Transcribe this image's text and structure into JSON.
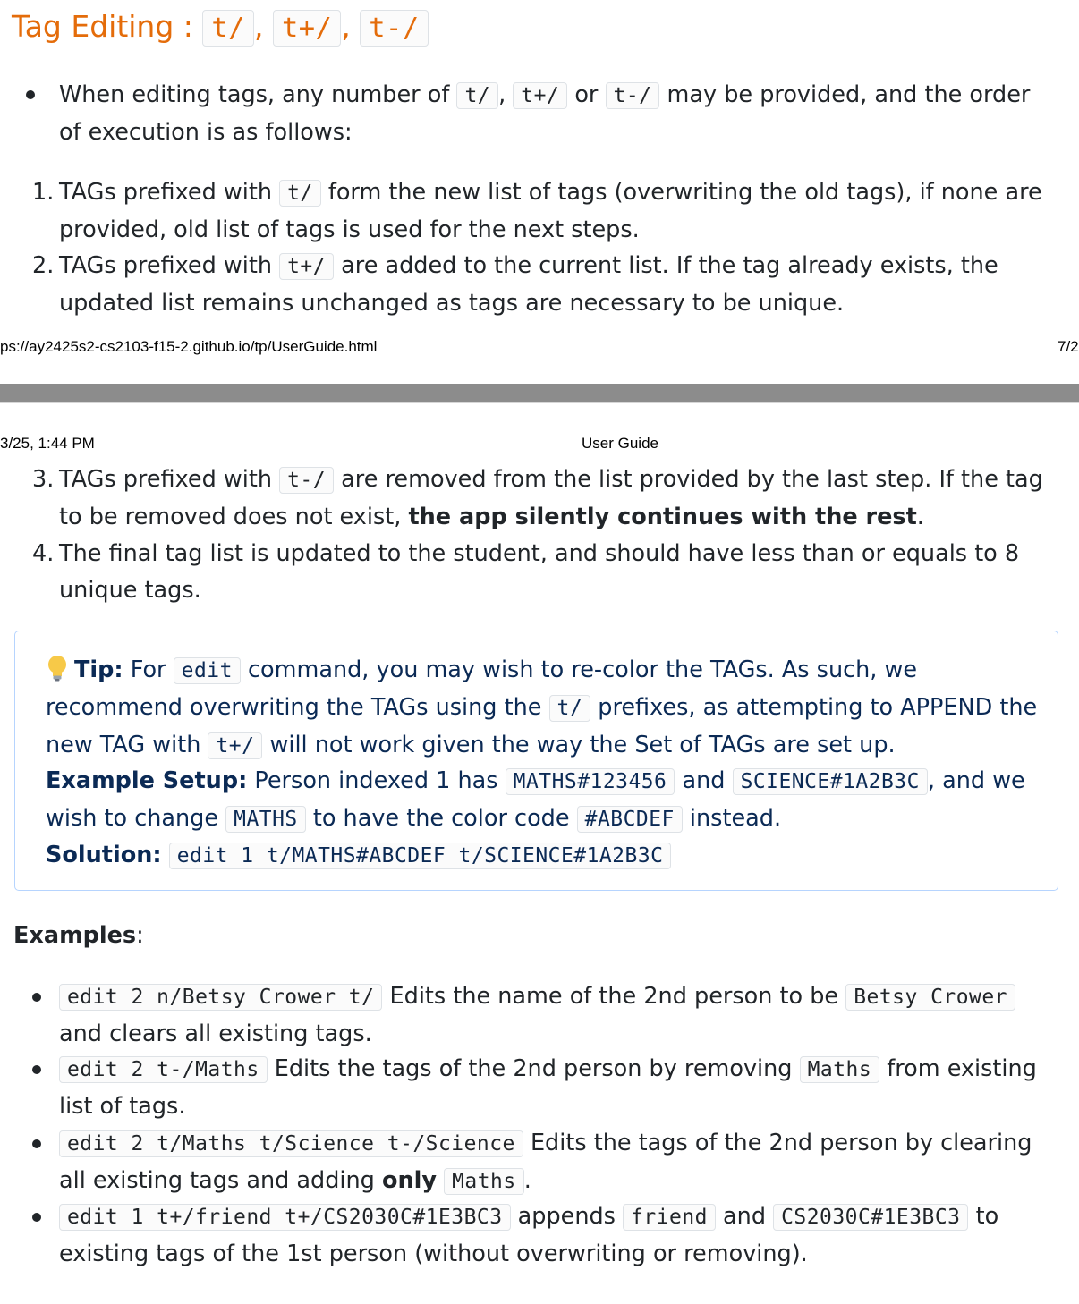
{
  "heading": {
    "text": "Tag Editing : ",
    "code1": "t/",
    "sep1": ", ",
    "code2": "t+/",
    "sep2": ", ",
    "code3": "t-/"
  },
  "intro": {
    "t1": "When editing tags, any number of ",
    "c1": "t/",
    "t2": ", ",
    "c2": "t+/",
    "t3": " or ",
    "c3": "t-/",
    "t4": " may be provided, and the order of execution is as follows:"
  },
  "steps": [
    {
      "num": "1.",
      "t1": "TAGs prefixed with ",
      "code": "t/",
      "t2": " form the new list of tags (overwriting the old tags), if none are provided, old list of tags is used for the next steps."
    },
    {
      "num": "2.",
      "t1": "TAGs prefixed with ",
      "code": "t+/",
      "t2": " are added to the current list. If the tag already exists, the updated list remains unchanged as tags are necessary to be unique."
    },
    {
      "num": "3.",
      "t1": "TAGs prefixed with ",
      "code": "t-/",
      "t2": " are removed from the list provided by the last step. If the tag to be removed does not exist, ",
      "bold": "the app silently continues with the rest",
      "t3": "."
    },
    {
      "num": "4.",
      "t1": "The final tag list is updated to the student, and should have less than or equals to 8 unique tags."
    }
  ],
  "print": {
    "footer_url": "ps://ay2425s2-cs2103-f15-2.github.io/tp/UserGuide.html",
    "footer_page": "7/2",
    "header_date": "3/25, 1:44 PM",
    "header_title": "User Guide"
  },
  "tip": {
    "icon": "lightbulb-icon",
    "label": "Tip:",
    "t1": " For ",
    "c1": "edit",
    "t2": " command, you may wish to re-color the TAGs. As such, we recommend overwriting the TAGs using the ",
    "c2": "t/",
    "t3": " prefixes, as attempting to APPEND the new TAG with ",
    "c3": "t+/",
    "t4": " will not work given the way the Set of TAGs are set up.",
    "setup_label": "Example Setup:",
    "s1": " Person indexed 1 has ",
    "sc1": "MATHS#123456",
    "s2": " and ",
    "sc2": "SCIENCE#1A2B3C",
    "s3": ", and we wish to change ",
    "sc3": "MATHS",
    "s4": " to have the color code ",
    "sc4": "#ABCDEF",
    "s5": " instead.",
    "solution_label": "Solution:",
    "solution_code": "edit 1 t/MATHS#ABCDEF t/SCIENCE#1A2B3C"
  },
  "examples": {
    "label": "Examples",
    "colon": ":",
    "items": [
      {
        "code": "edit 2 n/Betsy Crower t/",
        "t1": " Edits the name of the 2nd person to be ",
        "c2": "Betsy Crower",
        "t2": " and clears all existing tags."
      },
      {
        "code": "edit 2 t-/Maths",
        "t1": " Edits the tags of the 2nd person by removing ",
        "c2": "Maths",
        "t2": " from existing list of tags."
      },
      {
        "code": "edit 2 t/Maths t/Science t-/Science",
        "t1": " Edits the tags of the 2nd person by clearing all existing tags and adding ",
        "bold": "only",
        "t2": " ",
        "c2": "Maths",
        "t3": "."
      },
      {
        "code": "edit 1 t+/friend t+/CS2030C#1E3BC3",
        "t1": " appends ",
        "c2": "friend",
        "t2": " and ",
        "c3": "CS2030C#1E3BC3",
        "t3": " to existing tags of the 1st person (without overwriting or removing)."
      }
    ]
  },
  "colors": {
    "heading": "#e46c0a",
    "tip_text": "#0b2a55",
    "tip_border": "#b6d4fe",
    "separator": "#8c8c8c"
  }
}
